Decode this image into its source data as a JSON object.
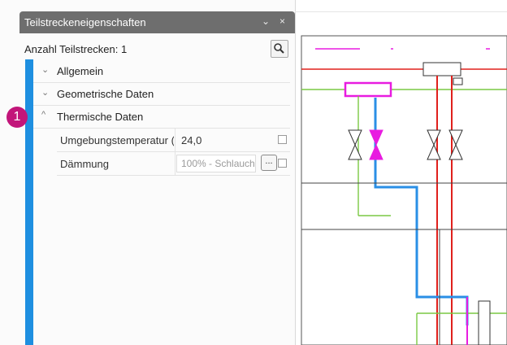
{
  "panel": {
    "title": "Teilstreckeneigenschaften",
    "collapse_glyph": "⌄",
    "close_glyph": "×",
    "count_label": "Anzahl Teilstrecken: 1"
  },
  "groups": [
    {
      "label": "Allgemein",
      "expanded": false
    },
    {
      "label": "Geometrische Daten",
      "expanded": false
    },
    {
      "label": "Thermische Daten",
      "expanded": true
    }
  ],
  "chevrons": {
    "collapsed": "⌄",
    "expanded": "^"
  },
  "properties": [
    {
      "name": "Umgebungstemperatur (",
      "value": "24,0"
    },
    {
      "name": "Dämmung",
      "value": "100% - Schlauch",
      "button": "..."
    }
  ],
  "badge": {
    "label": "1",
    "color": "#c2157a"
  },
  "colors": {
    "accent_bar": "#1e8fe0",
    "pipe_magenta": "#e81ce0",
    "pipe_red": "#e0201c",
    "pipe_green": "#7ac943",
    "pipe_blue": "#2a8fe6"
  }
}
